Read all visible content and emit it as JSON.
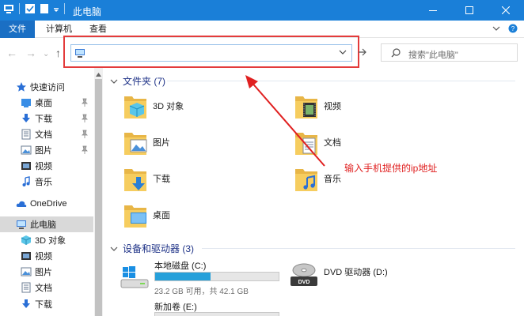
{
  "window": {
    "title": "此电脑",
    "accent": "#1a7fd8"
  },
  "ribbon": {
    "file_tab": "文件",
    "tabs": [
      "计算机",
      "查看"
    ]
  },
  "address": {
    "value": "",
    "search_placeholder": "搜索\"此电脑\""
  },
  "sidebar": {
    "items": [
      {
        "label": "快速访问",
        "icon": "star-icon"
      },
      {
        "label": "桌面",
        "icon": "desktop-icon",
        "pinned": true
      },
      {
        "label": "下载",
        "icon": "download-icon",
        "pinned": true
      },
      {
        "label": "文档",
        "icon": "document-icon",
        "pinned": true
      },
      {
        "label": "图片",
        "icon": "picture-icon",
        "pinned": true
      },
      {
        "label": "视频",
        "icon": "video-icon"
      },
      {
        "label": "音乐",
        "icon": "music-icon"
      },
      {
        "label": "OneDrive",
        "icon": "cloud-icon"
      },
      {
        "label": "此电脑",
        "icon": "computer-icon",
        "selected": true
      },
      {
        "label": "3D 对象",
        "icon": "cube-icon"
      },
      {
        "label": "视频",
        "icon": "video-icon"
      },
      {
        "label": "图片",
        "icon": "picture-icon"
      },
      {
        "label": "文档",
        "icon": "document-icon"
      },
      {
        "label": "下载",
        "icon": "download-icon"
      }
    ]
  },
  "folders_group": {
    "header": "文件夹 (7)",
    "items": [
      {
        "label": "3D 对象",
        "icon": "cube-folder-icon"
      },
      {
        "label": "视频",
        "icon": "video-folder-icon"
      },
      {
        "label": "图片",
        "icon": "picture-folder-icon"
      },
      {
        "label": "文档",
        "icon": "document-folder-icon"
      },
      {
        "label": "下载",
        "icon": "download-folder-icon"
      },
      {
        "label": "音乐",
        "icon": "music-folder-icon"
      },
      {
        "label": "桌面",
        "icon": "desktop-folder-icon"
      }
    ]
  },
  "drives_group": {
    "header": "设备和驱动器 (3)",
    "drives": [
      {
        "label": "本地磁盘 (C:)",
        "free_text": "23.2 GB 可用，共 42.1 GB",
        "used_fraction": 0.45,
        "icon": "windows-drive-icon"
      },
      {
        "label": "DVD 驱动器 (D:)",
        "icon": "dvd-drive-icon"
      },
      {
        "label": "新加卷 (E:)",
        "icon": "drive-icon"
      }
    ]
  },
  "annotation": {
    "text": "输入手机提供的ip地址",
    "color": "#e02020"
  }
}
